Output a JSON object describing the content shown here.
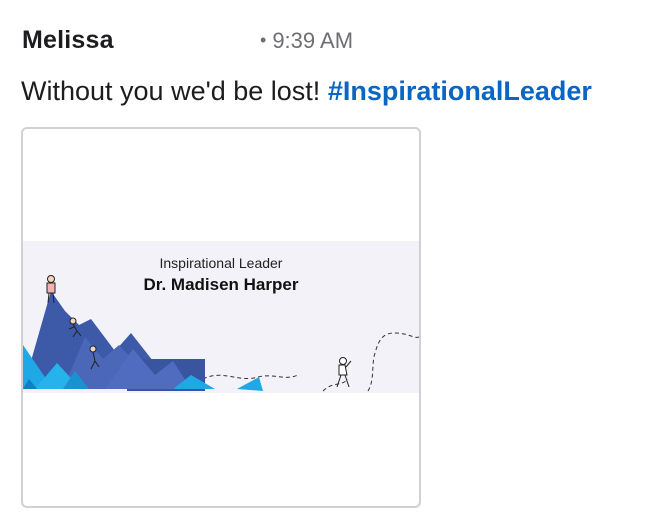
{
  "message": {
    "author": "Melissa",
    "time_separator": "•",
    "time": "9:39 AM",
    "text": "Without you we'd be lost! ",
    "hashtag": "#InspirationalLeader"
  },
  "card": {
    "banner_subtitle": "Inspirational Leader",
    "banner_title": "Dr. Madisen Harper",
    "illustration": "mountain-climbers-illustration"
  },
  "colors": {
    "hashtag": "#0a66c2",
    "banner_bg": "#f3f2f8",
    "mountain_dark": "#3d5aa8",
    "mountain_accent": "#1fa8e6"
  }
}
